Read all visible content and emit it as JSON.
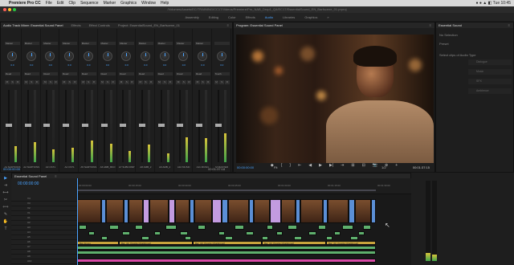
{
  "menubar": {
    "app": "Premiere Pro CC",
    "items": [
      "File",
      "Edit",
      "Clip",
      "Sequence",
      "Marker",
      "Graphics",
      "Window",
      "Help"
    ],
    "status": "● ●  ▲ ◧  Tue 10:45"
  },
  "window": {
    "title": "/Volumes/Assets/EC/TRAINING/CC17/Videos/Premiere/Pro_NAB_Drop1_Q4/EC17/EssentialSound_EN_Barfscene_01.prproj"
  },
  "workspaces": {
    "items": [
      "Assembly",
      "Editing",
      "Color",
      "Effects",
      "Audio",
      "Libraries",
      "Graphics"
    ],
    "active": "Audio",
    "menu": "»"
  },
  "mixer": {
    "tabs": [
      "Audio Track Mixer: Essential Sound Panel",
      "Effects",
      "Effect Controls",
      "Project: EssentialSound_EN_Barfscene_01"
    ],
    "tab_menu": "≡",
    "channels": [
      {
        "sel": "Master",
        "read": "Read",
        "name": "A1",
        "label": "NARTIONS"
      },
      {
        "sel": "Master",
        "read": "Read",
        "name": "A2",
        "label": "NARTIONS"
      },
      {
        "sel": "Master",
        "read": "Read",
        "name": "A3",
        "label": "CST1"
      },
      {
        "sel": "Master",
        "read": "Read",
        "name": "A4",
        "label": "CST1"
      },
      {
        "sel": "Master",
        "read": "Read",
        "name": "A5",
        "label": "NARTIONS"
      },
      {
        "sel": "Master",
        "read": "Read",
        "name": "A6",
        "label": "AMB_BKO"
      },
      {
        "sel": "Master",
        "read": "Read",
        "name": "A7",
        "label": "SUBCOMP"
      },
      {
        "sel": "Master",
        "read": "Read",
        "name": "A8",
        "label": "AMB_2"
      },
      {
        "sel": "Master",
        "read": "Read",
        "name": "A9",
        "label": "AMB_2"
      },
      {
        "sel": "Master",
        "read": "Read",
        "name": "A10",
        "label": "MUSIC"
      },
      {
        "sel": "Master",
        "read": "Read",
        "name": "A11",
        "label": "MUSIC"
      },
      {
        "sel": "",
        "read": "Touch",
        "name": "M",
        "label": "MASTER"
      }
    ],
    "knob_value": "0.0",
    "msr": [
      "M",
      "S",
      "R"
    ],
    "meter_levels": [
      0.22,
      0.28,
      0.18,
      0.2,
      0.3,
      0.26,
      0.16,
      0.24,
      0.12,
      0.35,
      0.33,
      0.4
    ],
    "time_left": "00:00:00:00",
    "time_right": "00:01:37:18"
  },
  "program": {
    "tab": "Program: Essential Sound Panel",
    "menu": "≡",
    "time": "00:00:00:00",
    "fit": "Fit",
    "full": "1/2",
    "duration": "00:01:37:15",
    "controls": [
      "◆",
      "{",
      "}",
      "⇤",
      "◀",
      "▶",
      "▶|",
      "⇥",
      "⊞",
      "⊟",
      "📷",
      "⊕",
      "+"
    ]
  },
  "essential": {
    "tab": "Essential Sound",
    "menu": "≡",
    "no_sel": "No Selection",
    "preset": "Preset",
    "hint": "Select clips of Audio Type",
    "buttons": [
      "Dialogue",
      "Music",
      "SFX",
      "Ambience"
    ]
  },
  "timeline": {
    "tab": "Essential Sound Panel",
    "menu": "≡",
    "timecode": "00:00:00:00",
    "ruler": [
      "00:00:00:00",
      "00:00:15:00",
      "00:00:30:00",
      "00:00:45:00",
      "00:01:00:00",
      "00:01:15:00",
      "00:01:30:00"
    ],
    "tracks": [
      "V4",
      "V3",
      "V2",
      "V1",
      "A1",
      "A2",
      "A3",
      "A4",
      "A5",
      "A6",
      "A7",
      "A8",
      "A9",
      "A10"
    ],
    "music_labels": [
      "Bar Atmos",
      "Bar_03_People Chatting.aif",
      "Bar_03_People Chatting.aif",
      "Bar_03_People Chatting.aif",
      "Bar_03_People Chatting.aif"
    ]
  },
  "tools": [
    "▶",
    "⇥",
    "⟷",
    "✂",
    "⟺",
    "✎",
    "✋",
    "T"
  ],
  "colors": {
    "accent": "#4aa3ff",
    "audio_clip": "#5fb06d",
    "music_clip": "#c9a33c",
    "adjustment": "#c39be0",
    "pink": "#d94aa6"
  }
}
